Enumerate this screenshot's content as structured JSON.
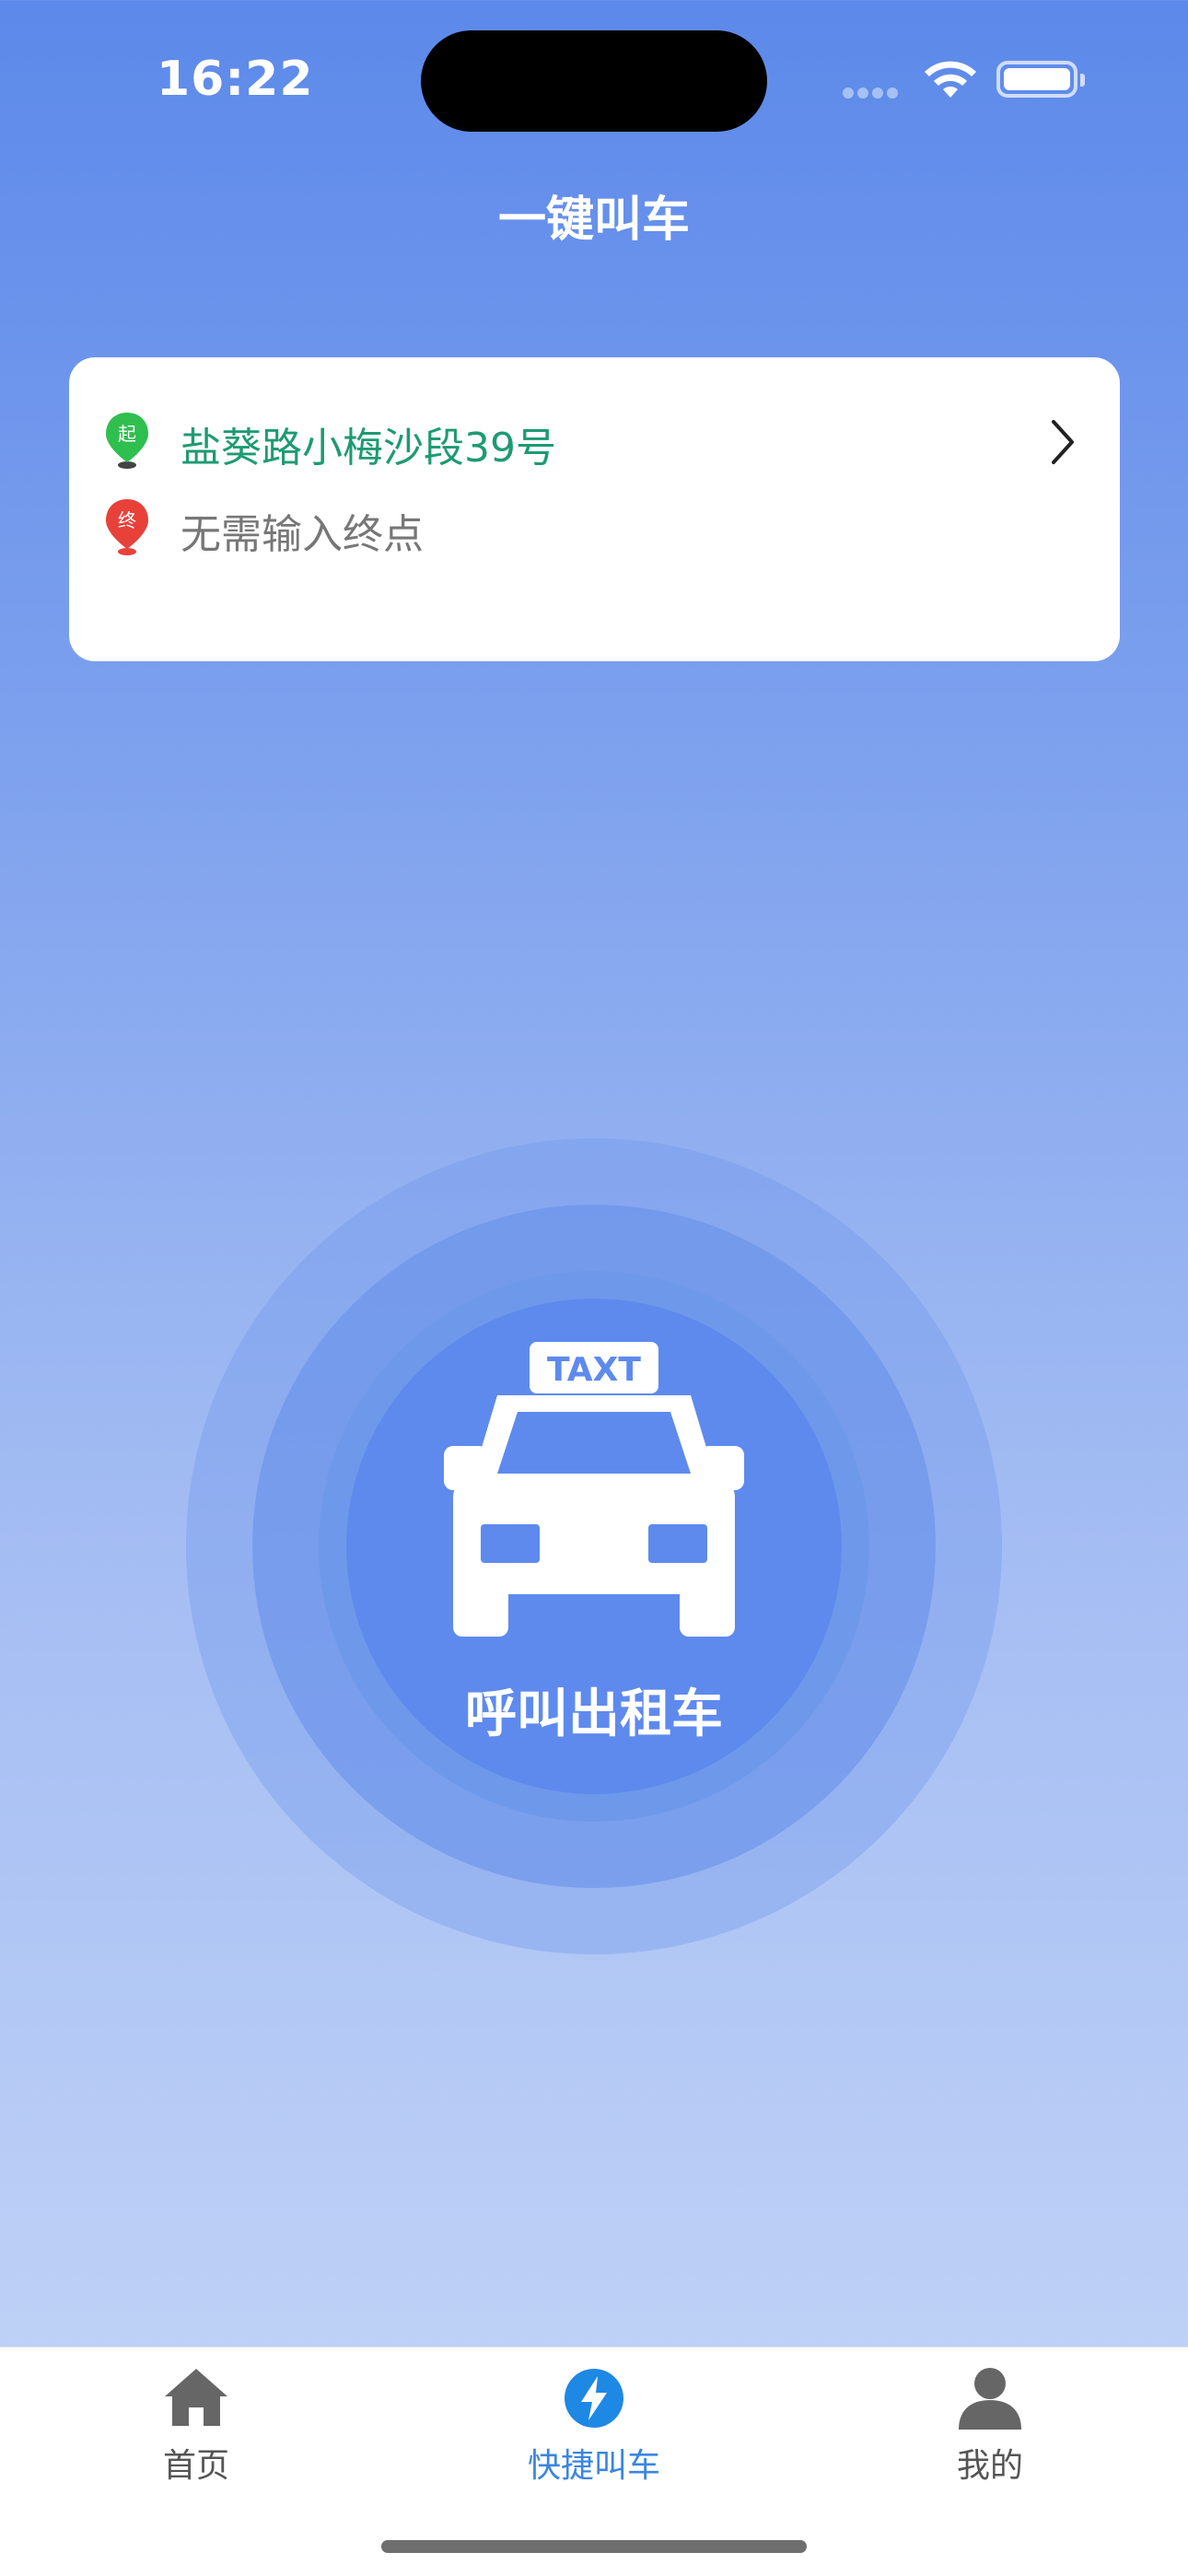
{
  "status_bar": {
    "time": "16:22"
  },
  "header": {
    "title": "一键叫车"
  },
  "route_card": {
    "start_badge": "起",
    "start_address": "盐葵路小梅沙段39号",
    "end_badge": "终",
    "end_placeholder": "无需输入终点"
  },
  "call_button": {
    "sign_text": "TAXT",
    "label": "呼叫出租车"
  },
  "tabbar": {
    "tabs": [
      {
        "label": "首页",
        "icon": "home-icon"
      },
      {
        "label": "快捷叫车",
        "icon": "lightning-icon",
        "active": true
      },
      {
        "label": "我的",
        "icon": "user-icon"
      }
    ]
  },
  "colors": {
    "accent": "#3b86e0",
    "start_green": "#1e9a73",
    "end_red": "#e8413a"
  }
}
